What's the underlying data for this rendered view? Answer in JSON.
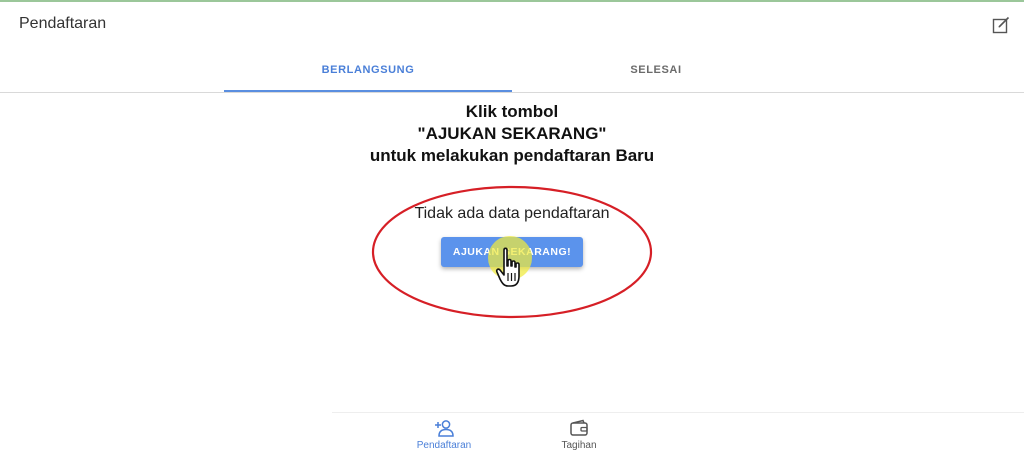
{
  "header": {
    "title": "Pendaftaran",
    "action_icon": "edit-icon"
  },
  "tabs": [
    {
      "label": "BERLANGSUNG",
      "active": true
    },
    {
      "label": "SELESAI",
      "active": false
    }
  ],
  "main": {
    "instruction_lines": [
      "Klik tombol",
      "\"AJUKAN SEKARANG\"",
      "untuk melakukan pendaftaran Baru"
    ],
    "empty_message": "Tidak ada data pendaftaran",
    "submit_button_label": "AJUKAN SEKARANG!"
  },
  "bottom_nav": [
    {
      "label": "Pendaftaran",
      "icon": "add-person-icon",
      "active": true
    },
    {
      "label": "Tagihan",
      "icon": "wallet-icon",
      "active": false
    }
  ],
  "colors": {
    "accent": "#5a8ee0",
    "button": "#5b93ec",
    "highlight_circle": "#d61f26",
    "cursor_highlight": "#f0ea3c"
  }
}
